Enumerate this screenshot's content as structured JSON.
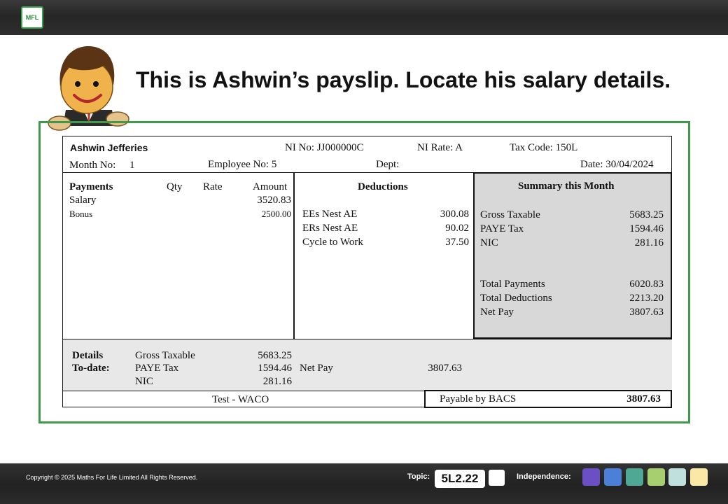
{
  "app": {
    "logo_text": "MFL",
    "headline": "This is Ashwin’s payslip.  Locate his salary details."
  },
  "payslip": {
    "employee_name": "Ashwin Jefferies",
    "ni_no": "NI No: JJ000000C",
    "ni_rate": "NI Rate: A",
    "tax_code": "Tax Code: 150L",
    "month_no_label": "Month No:",
    "month_no": "1",
    "employee_no": "Employee No: 5",
    "dept": "Dept:",
    "date": "Date:  30/04/2024",
    "payments": {
      "header": "Payments",
      "qty_label": "Qty",
      "rate_label": "Rate",
      "amount_label": "Amount",
      "items": [
        {
          "label": "Salary",
          "amount": "3520.83"
        },
        {
          "label": "Bonus",
          "amount": "2500.00"
        }
      ]
    },
    "deductions": {
      "header": "Deductions",
      "items": [
        {
          "label": "EEs Nest AE",
          "amount": "300.08"
        },
        {
          "label": "ERs Nest AE",
          "amount": "90.02"
        },
        {
          "label": "Cycle to Work",
          "amount": "37.50"
        }
      ]
    },
    "summary": {
      "header": "Summary this Month",
      "items": [
        {
          "label": "Gross Taxable",
          "amount": "5683.25"
        },
        {
          "label": "PAYE Tax",
          "amount": "1594.46"
        },
        {
          "label": "NIC",
          "amount": "281.16"
        }
      ],
      "totals": [
        {
          "label": "Total Payments",
          "amount": "6020.83"
        },
        {
          "label": "Total Deductions",
          "amount": "2213.20"
        },
        {
          "label": "Net Pay",
          "amount": "3807.63"
        }
      ]
    },
    "details_to_date": {
      "label_line1": "Details",
      "label_line2": "To-date:",
      "items": [
        {
          "label": "Gross Taxable",
          "amount": "5683.25"
        },
        {
          "label": "PAYE Tax",
          "amount": "1594.46"
        },
        {
          "label": "NIC",
          "amount": "281.16"
        }
      ],
      "net_pay_label": "Net Pay",
      "net_pay": "3807.63"
    },
    "employer": "Test - WACO",
    "payable_label": "Payable by BACS",
    "payable_amount": "3807.63"
  },
  "footer": {
    "copyright": "Copyright © 2025 Maths For Life Limited All Rights Reserved.",
    "topic_label": "Topic:",
    "topic_value": "5L2.22",
    "independence_label": "Independence:",
    "independence_colors": [
      "#6b4fc4",
      "#4c7fd8",
      "#4fa894",
      "#a8cf6f",
      "#bfe0dc",
      "#fbe7a6"
    ]
  }
}
